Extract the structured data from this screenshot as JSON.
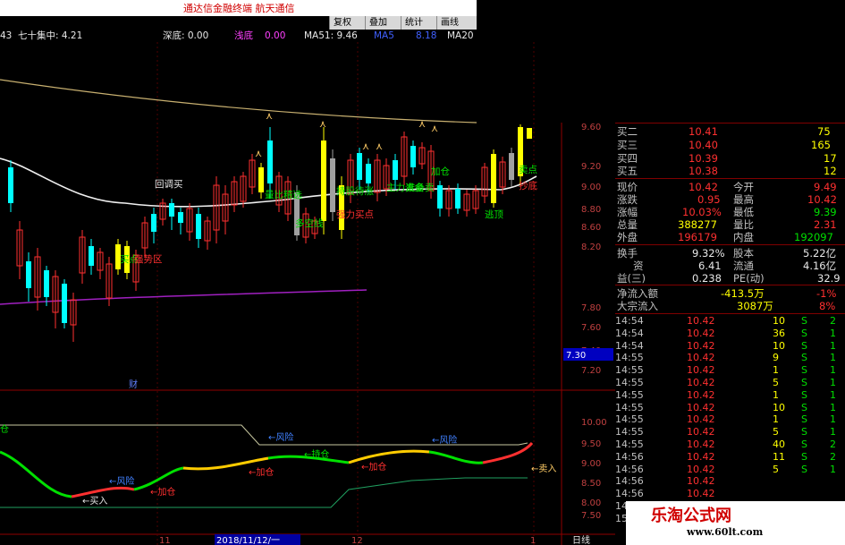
{
  "app_title": "通达信金融终端  航天通信",
  "toolbar": [
    "复权",
    "叠加",
    "统计",
    "画线"
  ],
  "infobar": {
    "code": "43",
    "indicator": "七十集中: 4.21",
    "deep_label": "深底: 0.00",
    "shallow_label": "浅底",
    "shallow_val": "0.00",
    "ma51": "MA51: 9.46",
    "ma_blue": "MA5",
    "ma_blue_val": "8.18",
    "ma20": "MA20"
  },
  "main_chart": {
    "price_axis": [
      "9.60",
      "9.20",
      "9.00",
      "8.80",
      "8.60",
      "8.20",
      "7.80",
      "7.60",
      "7.40",
      "7.20"
    ],
    "last_price_tag": "7.30",
    "annotations": [
      "回调买",
      "量比精选",
      "持股待涨",
      "主力资金",
      "准备卖",
      "加仓",
      "多空线",
      "强力买点",
      "卖点",
      "买点",
      "强势区",
      "抄底",
      "逃顶"
    ],
    "bottom_label": "财"
  },
  "sub_chart": {
    "axis": [
      "10.00",
      "9.50",
      "9.00",
      "8.50",
      "8.00",
      "7.50"
    ],
    "labels": {
      "risk1": "←风险",
      "risk2": "←风险",
      "risk3": "←风险",
      "buy": "←买入",
      "add1": "←加仓",
      "add2": "←加仓",
      "add3": "←加仓",
      "hold": "←持仓",
      "sell": "←卖入",
      "cang": "仓"
    }
  },
  "date_axis": {
    "t1": "11",
    "date": "2018/11/12/一",
    "t2": "12",
    "t3": "1",
    "mode": "日线"
  },
  "quote": {
    "asks": [
      {
        "label": "买二",
        "price": "10.41",
        "vol": "75"
      },
      {
        "label": "买三",
        "price": "10.40",
        "vol": "165"
      },
      {
        "label": "买四",
        "price": "10.39",
        "vol": "17"
      },
      {
        "label": "买五",
        "price": "10.38",
        "vol": "12"
      }
    ],
    "stats": [
      {
        "l1": "现价",
        "v1": "10.42",
        "l2": "今开",
        "v2": "9.49"
      },
      {
        "l1": "涨跌",
        "v1": "0.95",
        "l2": "最高",
        "v2": "10.42"
      },
      {
        "l1": "涨幅",
        "v1": "10.03%",
        "l2": "最低",
        "v2": "9.39"
      },
      {
        "l1": "总量",
        "v1": "388277",
        "l2": "量比",
        "v2": "2.31"
      },
      {
        "l1": "外盘",
        "v1": "196179",
        "l2": "内盘",
        "v2": "192097"
      }
    ],
    "fund": [
      {
        "l1": "换手",
        "v1": "9.32%",
        "l2": "股本",
        "v2": "5.22亿"
      },
      {
        "l1": "资",
        "v1": "6.41",
        "l2": "流通",
        "v2": "4.16亿"
      },
      {
        "l1": "益(三)",
        "v1": "0.238",
        "l2": "PE(动)",
        "v2": "32.9"
      }
    ],
    "flow": [
      {
        "label": "净流入额",
        "val": "-413.5万",
        "pct": "-1%"
      },
      {
        "label": "大宗流入",
        "val": "3087万",
        "pct": "8%"
      }
    ]
  },
  "ticks": [
    {
      "t": "14:54",
      "p": "10.42",
      "v": "10",
      "s": "S",
      "n": "2"
    },
    {
      "t": "14:54",
      "p": "10.42",
      "v": "36",
      "s": "S",
      "n": "1"
    },
    {
      "t": "14:54",
      "p": "10.42",
      "v": "10",
      "s": "S",
      "n": "1"
    },
    {
      "t": "14:55",
      "p": "10.42",
      "v": "9",
      "s": "S",
      "n": "1"
    },
    {
      "t": "14:55",
      "p": "10.42",
      "v": "1",
      "s": "S",
      "n": "1"
    },
    {
      "t": "14:55",
      "p": "10.42",
      "v": "5",
      "s": "S",
      "n": "1"
    },
    {
      "t": "14:55",
      "p": "10.42",
      "v": "1",
      "s": "S",
      "n": "1"
    },
    {
      "t": "14:55",
      "p": "10.42",
      "v": "10",
      "s": "S",
      "n": "1"
    },
    {
      "t": "14:55",
      "p": "10.42",
      "v": "1",
      "s": "S",
      "n": "1"
    },
    {
      "t": "14:55",
      "p": "10.42",
      "v": "5",
      "s": "S",
      "n": "1"
    },
    {
      "t": "14:55",
      "p": "10.42",
      "v": "40",
      "s": "S",
      "n": "2"
    },
    {
      "t": "14:56",
      "p": "10.42",
      "v": "11",
      "s": "S",
      "n": "2"
    },
    {
      "t": "14:56",
      "p": "10.42",
      "v": "5",
      "s": "S",
      "n": "1"
    },
    {
      "t": "14:56",
      "p": "10.42",
      "v": "",
      "s": "",
      "n": ""
    },
    {
      "t": "14:56",
      "p": "10.42",
      "v": "",
      "s": "",
      "n": ""
    },
    {
      "t": "14:56",
      "p": "",
      "v": "",
      "s": "",
      "n": ""
    },
    {
      "t": "15:00",
      "p": "",
      "v": "",
      "s": "",
      "n": ""
    }
  ],
  "watermark": {
    "name": "乐淘公式网",
    "url": "www.60lt.com"
  }
}
